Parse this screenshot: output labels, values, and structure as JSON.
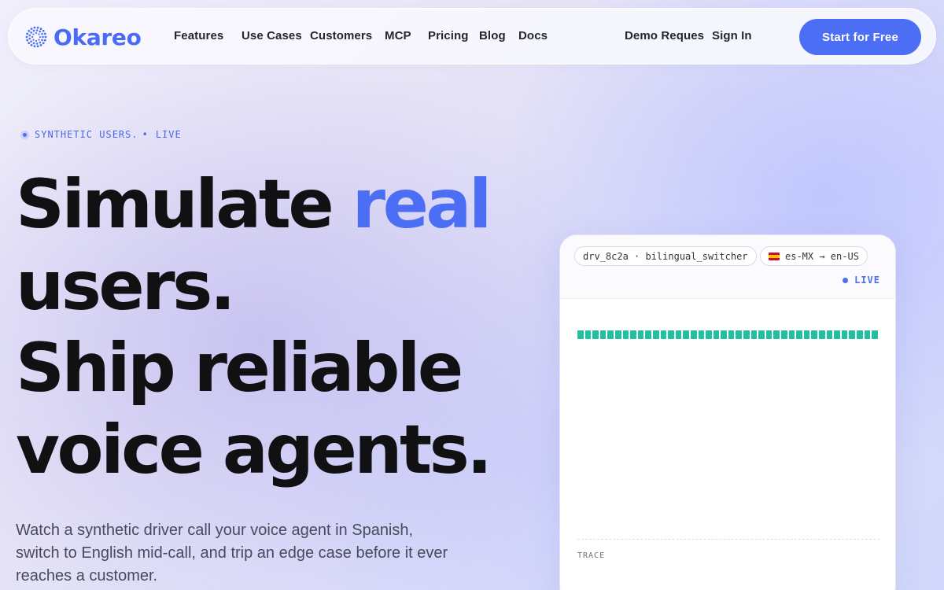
{
  "nav": {
    "logo_text": "Okareo",
    "items": [
      "Features",
      "Use Cases",
      "Customers",
      "MCP",
      "Pricing",
      "Blog",
      "Docs"
    ],
    "demo": "Demo Reques",
    "signin": "Sign In",
    "cta": "Start for Free"
  },
  "hero": {
    "eyebrow_1": "SYNTHETIC USERS.",
    "eyebrow_sep": "•",
    "eyebrow_2": "LIVE",
    "h_simulate": "Simulate ",
    "h_real": "real",
    "h_users": "users.",
    "h_ship": "Ship reliable",
    "h_voice": "voice agents.",
    "sub": "Watch a synthetic driver call your voice agent in Spanish, switch to English mid-call, and trip an edge case before it ever reaches a customer."
  },
  "card": {
    "session": "drv_8c2a · bilingual_switcher",
    "lang": "es-MX → en-US",
    "live": "LIVE",
    "trace": "TRACE",
    "wave_segments": 40
  },
  "colors": {
    "accent": "#4c6ef4",
    "wave": "#23bf9f",
    "headline": "#111114"
  },
  "icons": {
    "logo": "dotted-circle-logo-icon",
    "flag": "spain-flag-icon",
    "live": "live-dot-icon"
  }
}
